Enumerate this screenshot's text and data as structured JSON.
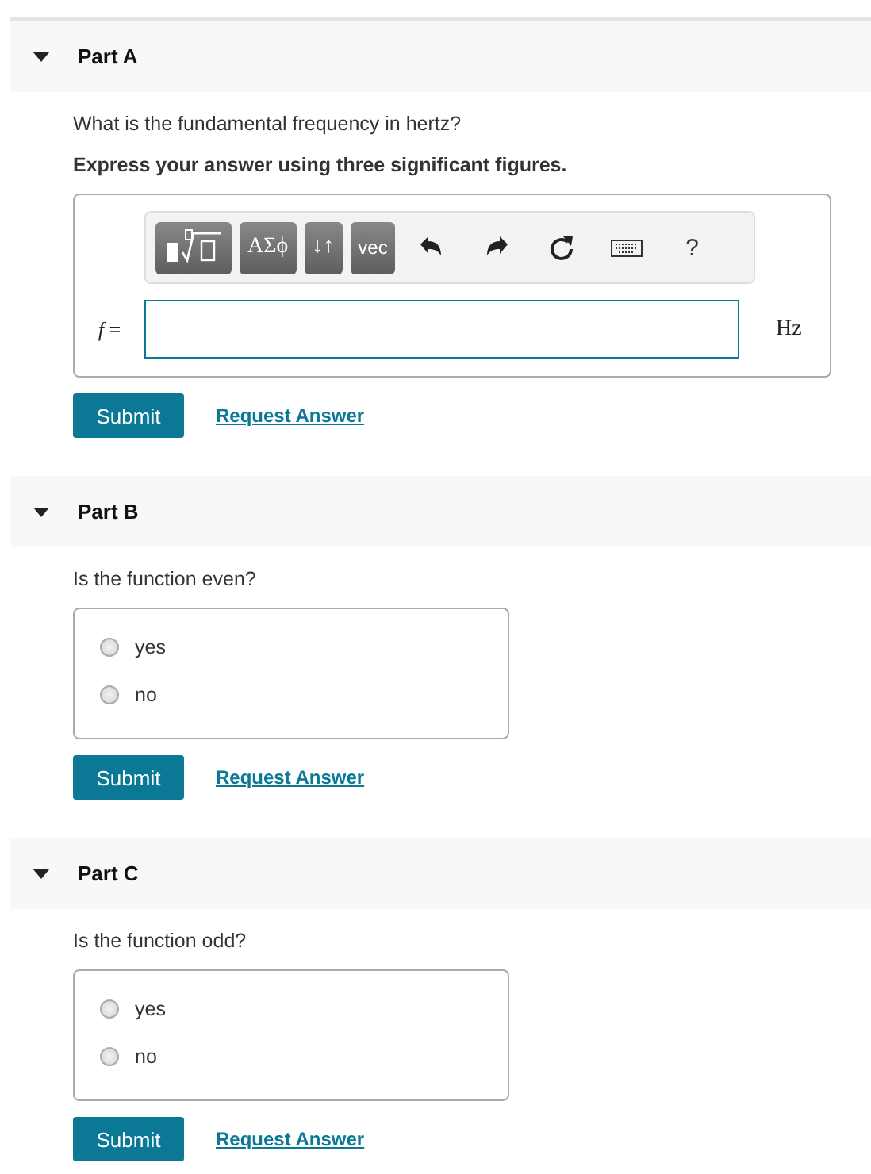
{
  "parts": [
    {
      "title": "Part A",
      "expanded": true,
      "kind": "math",
      "question": "What is the fundamental frequency in hertz?",
      "instruction": "Express your answer using three significant figures.",
      "toolbar": [
        {
          "kind": "template"
        },
        {
          "kind": "text",
          "label": "ΑΣϕ"
        },
        {
          "kind": "text",
          "label": "↓↑"
        },
        {
          "kind": "text",
          "label": "vec"
        },
        {
          "kind": "undo"
        },
        {
          "kind": "redo"
        },
        {
          "kind": "reset"
        },
        {
          "kind": "keyboard"
        },
        {
          "kind": "help",
          "label": "?"
        }
      ],
      "variable": "f",
      "equals": "=",
      "unit": "Hz",
      "submit": "Submit",
      "request": "Request Answer"
    },
    {
      "title": "Part B",
      "expanded": true,
      "kind": "choice",
      "question": "Is the function even?",
      "options": [
        {
          "label": "yes",
          "selected": false
        },
        {
          "label": "no",
          "selected": false
        }
      ],
      "submit": "Submit",
      "request": "Request Answer"
    },
    {
      "title": "Part C",
      "expanded": true,
      "kind": "choice",
      "question": "Is the function odd?",
      "options": [
        {
          "label": "yes",
          "selected": false
        },
        {
          "label": "no",
          "selected": false
        }
      ],
      "submit": "Submit",
      "request": "Request Answer"
    }
  ]
}
